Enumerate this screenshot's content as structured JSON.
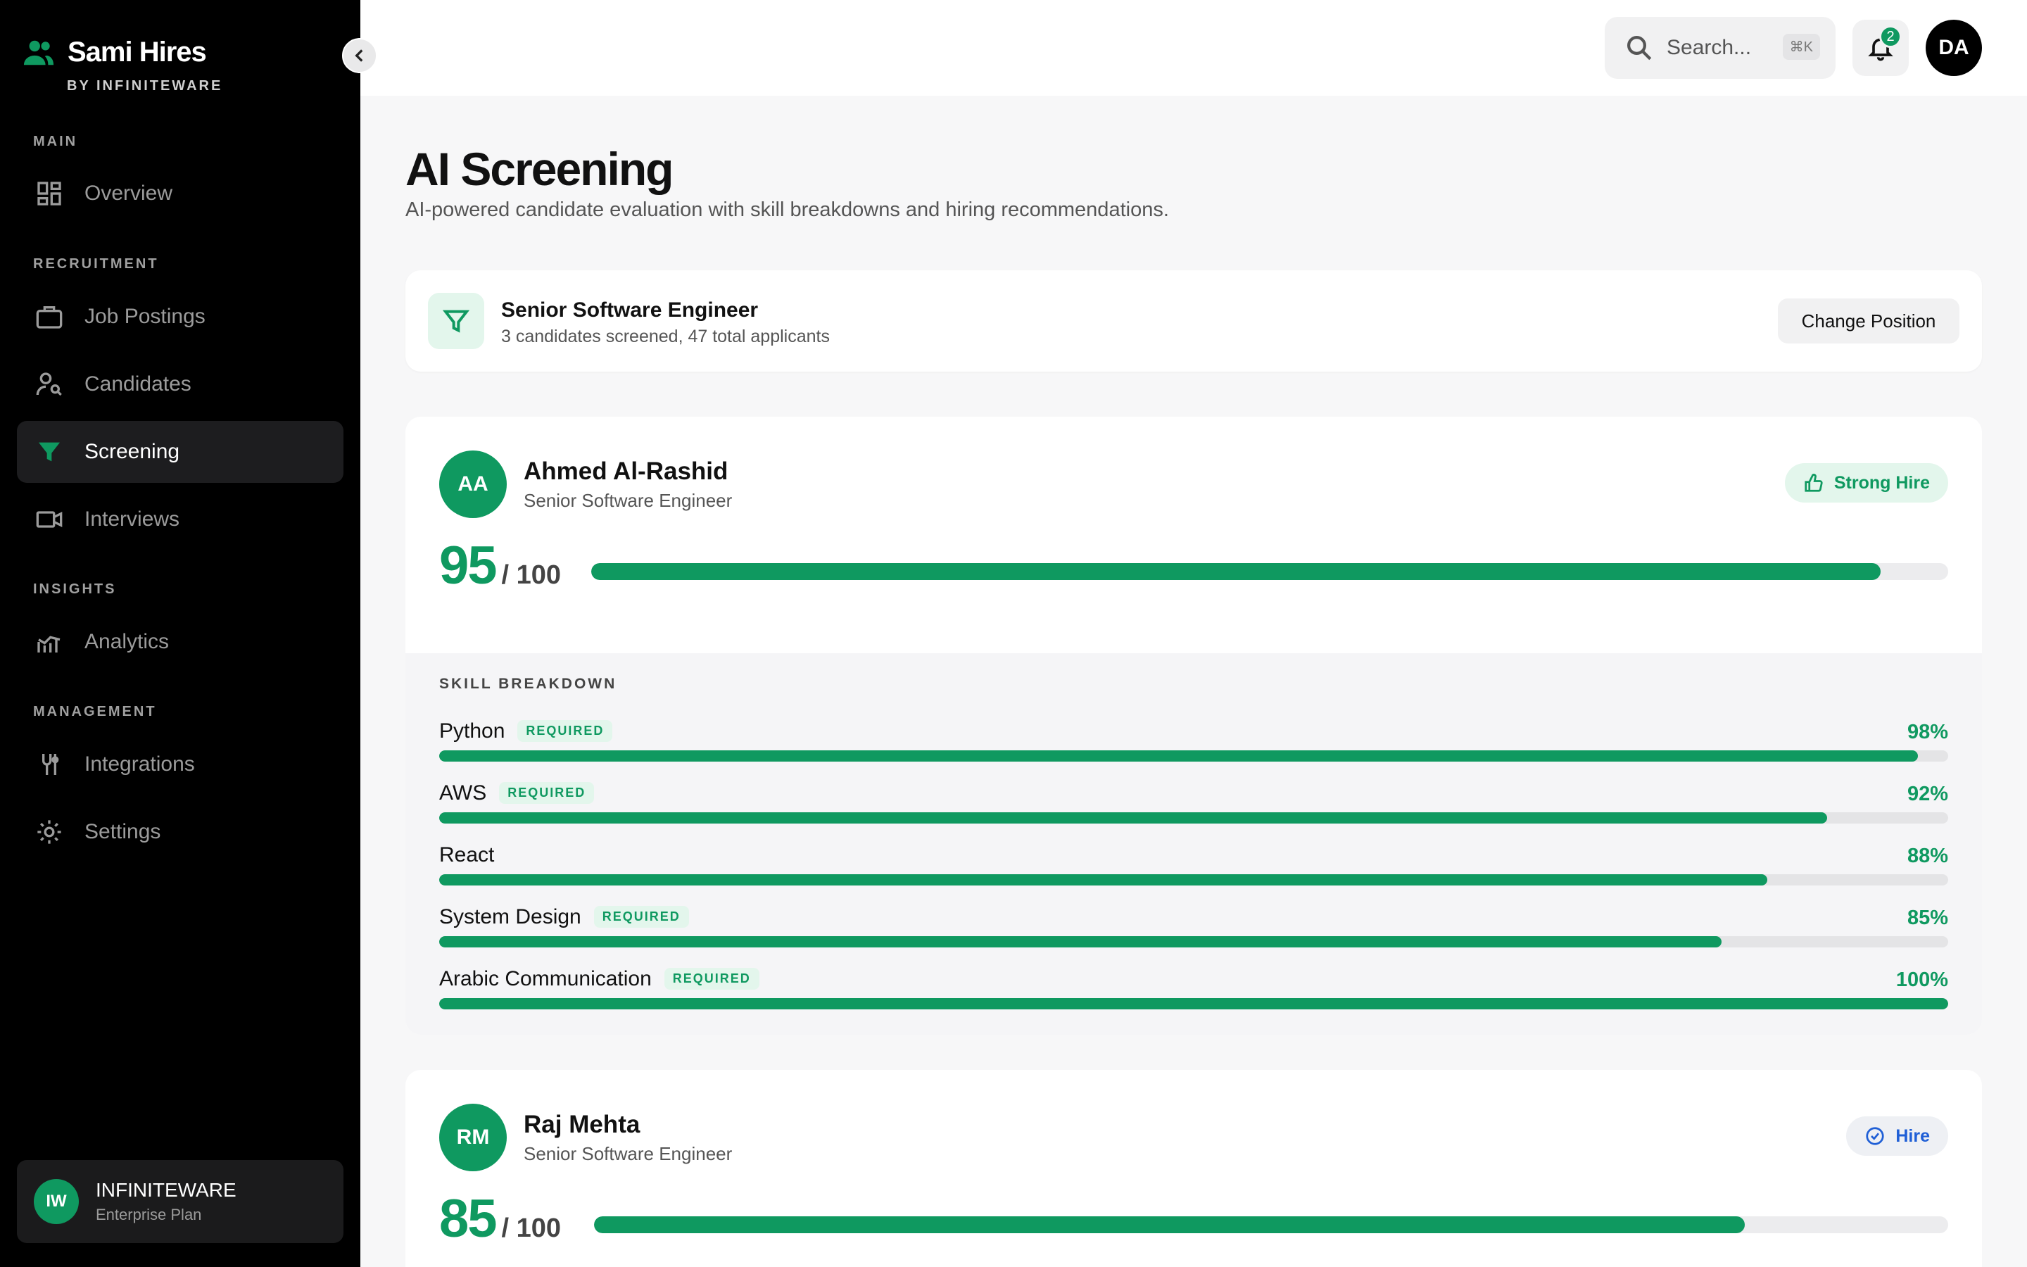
{
  "brand": {
    "name": "Sami Hires",
    "sub": "BY INFINITEWARE"
  },
  "colors": {
    "accent": "#0f9960",
    "hire_blue": "#1f5fd6",
    "sidebar_bg": "#000000"
  },
  "sidebar": {
    "sections": {
      "main": "MAIN",
      "recruitment": "RECRUITMENT",
      "insights": "INSIGHTS",
      "management": "MANAGEMENT"
    },
    "items": [
      {
        "label": "Overview",
        "icon": "dashboard-icon"
      },
      {
        "label": "Job Postings",
        "icon": "briefcase-icon"
      },
      {
        "label": "Candidates",
        "icon": "user-search-icon"
      },
      {
        "label": "Screening",
        "icon": "filter-icon",
        "active": true
      },
      {
        "label": "Interviews",
        "icon": "video-icon"
      },
      {
        "label": "Analytics",
        "icon": "analytics-icon"
      },
      {
        "label": "Integrations",
        "icon": "integrations-icon"
      },
      {
        "label": "Settings",
        "icon": "gear-icon"
      }
    ],
    "org": {
      "initials": "IW",
      "name": "INFINITEWARE",
      "plan": "Enterprise Plan"
    }
  },
  "header": {
    "search_placeholder": "Search...",
    "shortcut": "⌘K",
    "notification_count": "2",
    "user_initials": "DA"
  },
  "page": {
    "title": "AI Screening",
    "subtitle": "AI-powered candidate evaluation with skill breakdowns and hiring recommendations."
  },
  "position": {
    "title": "Senior Software Engineer",
    "summary": "3 candidates screened, 47 total applicants",
    "change_label": "Change Position"
  },
  "candidates": [
    {
      "initials": "AA",
      "name": "Ahmed Al-Rashid",
      "role": "Senior Software Engineer",
      "recommendation": "Strong Hire",
      "score": "95",
      "score_value": 95,
      "score_den": "/ 100",
      "skills_label": "SKILL BREAKDOWN",
      "required_label": "REQUIRED",
      "skills": [
        {
          "name": "Python",
          "required": true,
          "pct": "98%",
          "value": 98
        },
        {
          "name": "AWS",
          "required": true,
          "pct": "92%",
          "value": 92
        },
        {
          "name": "React",
          "required": false,
          "pct": "88%",
          "value": 88
        },
        {
          "name": "System Design",
          "required": true,
          "pct": "85%",
          "value": 85
        },
        {
          "name": "Arabic Communication",
          "required": true,
          "pct": "100%",
          "value": 100
        }
      ]
    },
    {
      "initials": "RM",
      "name": "Raj Mehta",
      "role": "Senior Software Engineer",
      "recommendation": "Hire",
      "score": "85",
      "score_value": 85,
      "score_den": "/ 100"
    }
  ]
}
